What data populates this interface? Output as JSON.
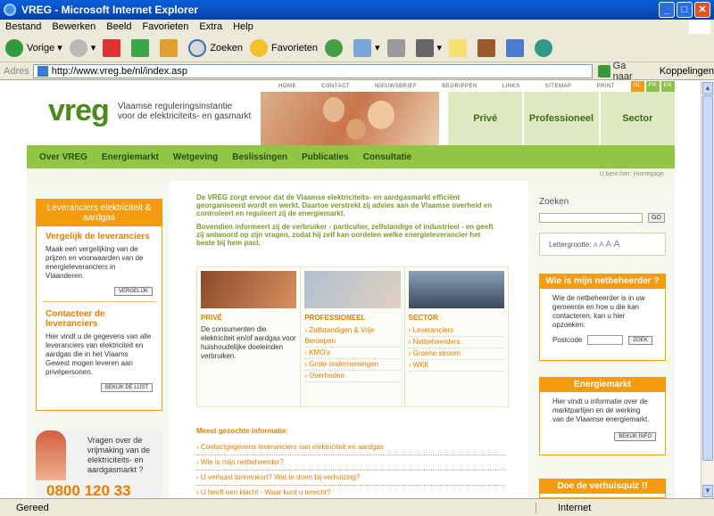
{
  "window": {
    "title": "VREG - Microsoft Internet Explorer"
  },
  "menu": [
    "Bestand",
    "Bewerken",
    "Beeld",
    "Favorieten",
    "Extra",
    "Help"
  ],
  "toolbar": {
    "back": "Vorige",
    "search": "Zoeken",
    "favorites": "Favorieten"
  },
  "address": {
    "label": "Adres",
    "url": "http://www.vreg.be/nl/index.asp",
    "go": "Ga naar",
    "links": "Koppelingen"
  },
  "site": {
    "topnav": [
      "HOME",
      "CONTACT",
      "NIEUWSBRIEF",
      "BEGRIPPEN",
      "LINKS",
      "SITEMAP",
      "PRINT"
    ],
    "lang": [
      "NL",
      "FR",
      "EN"
    ],
    "logo": "vreg",
    "tagline1": "Vlaamse reguleringsinstantie",
    "tagline2": "voor de elektriciteits- en gasmarkt",
    "segments": [
      "Privé",
      "Professioneel",
      "Sector"
    ],
    "mainnav": [
      "Over VREG",
      "Energiemarkt",
      "Wetgeving",
      "Beslissingen",
      "Publicaties",
      "Consultatie"
    ],
    "crumb": "U bent hier: Homepage",
    "left": {
      "header": "Leveranciers elektriciteit & aardgas",
      "s1_title": "Vergelijk de leveranciers",
      "s1_text": "Maak een vergelijking van de prijzen en voorwaarden van de energieleveranciers in Vlaanderen.",
      "s1_btn": "VERGELIJK",
      "s2_title": "Contacteer de leveranciers",
      "s2_text": "Hier vindt u de gegevens van alle leveranciers van elektriciteit en aardgas die in het Vlaams Gewest mogen leveren aan privépersonen.",
      "s2_btn": "BEKIJK DE LIJST",
      "help_q": "Vragen over de vrijmaking van de elektriciteits- en aardgasmarkt ?",
      "help_num": "0800 120 33"
    },
    "intro1": "De VREG zorgt ervoor dat de Vlaamse elektriciteits- en aardgasmarkt efficiënt georganiseerd wordt en werkt. Daartoe verstrekt zij advies aan de Vlaamse overheid en controleert en reguleert zij de energiemarkt.",
    "intro2": "Bovendien informeert zij de verbruiker - particulier, zelfstandige of industrieel - en geeft zij antwoord op zijn vragen, zodat hij zelf kan oordelen welke energieleverancier het beste bij hem past.",
    "cards": {
      "prive_title": "PRIVÉ",
      "prive_text": "De consumenten die elektriciteit en/of aardgas voor huishoudelijke doeleinden verbruiken.",
      "prof_title": "PROFESSIONEEL",
      "prof_links": [
        "Zelfstandigen & Vrije Beroepen",
        "KMO's",
        "Grote ondernemingen",
        "Overheden"
      ],
      "sector_title": "SECTOR",
      "sector_links": [
        "Leveranciers",
        "Netbeheerders",
        "Groene stroom",
        "WKK"
      ]
    },
    "faq": {
      "title": "Meest gezochte informatie:",
      "items": [
        "Contactgegevens leveranciers van elektriciteit en aardgas",
        "Wie is mijn netbeheerder?",
        "U verhuist binnenkort? Wat te doen bij verhuizing?",
        "U heeft een klacht - Waar kunt u terecht?"
      ]
    },
    "right": {
      "zoek": "Zoeken",
      "go": "GO",
      "fontsize": "Lettergrootte:",
      "nb_title": "Wie is mijn netbeheerder ?",
      "nb_text": "Wie de netbeheerder is in uw gemeente en hoe u die kan contacteren, kan u hier opzoeken:",
      "postcode": "Postcode",
      "zoek_btn": "ZOEK",
      "em_title": "Energiemarkt",
      "em_text": "Hier vindt u informatie over de marktpartijen en de werking van de Vlaamse energiemarkt.",
      "em_btn": "BEKIJK INFO",
      "quiz_title": "Doe de verhuisquiz !!"
    }
  },
  "status": {
    "text": "Gereed",
    "zone": "Internet"
  }
}
